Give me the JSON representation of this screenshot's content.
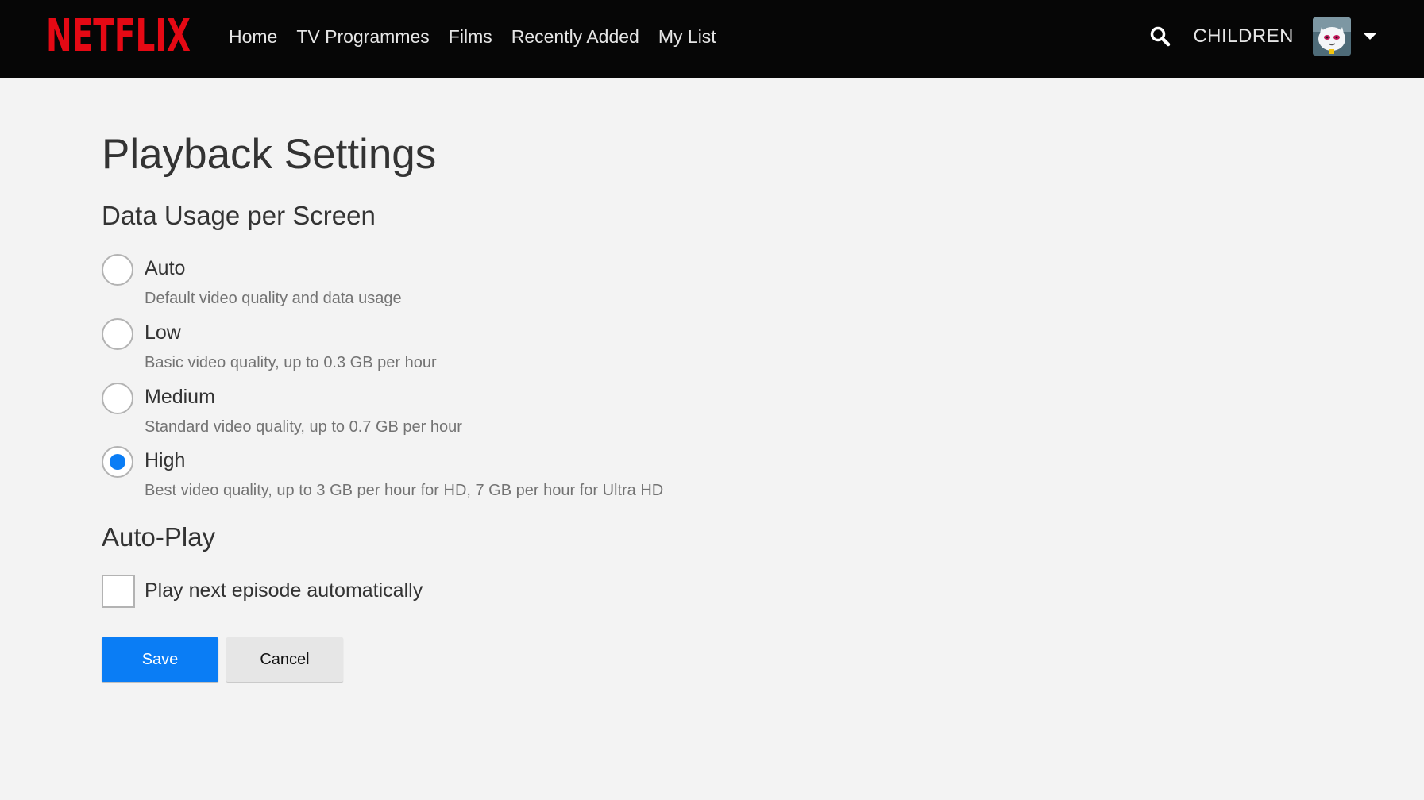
{
  "header": {
    "logo_text": "NETFLIX",
    "nav": [
      {
        "label": "Home"
      },
      {
        "label": "TV Programmes"
      },
      {
        "label": "Films"
      },
      {
        "label": "Recently Added"
      },
      {
        "label": "My List"
      }
    ],
    "profile_name": "CHILDREN",
    "icons": {
      "search": "search-icon",
      "avatar": "avatar",
      "dropdown": "chevron-down-icon"
    }
  },
  "page": {
    "title": "Playback Settings",
    "data_usage": {
      "heading": "Data Usage per Screen",
      "selected": "High",
      "options": [
        {
          "label": "Auto",
          "description": "Default video quality and data usage",
          "checked": false
        },
        {
          "label": "Low",
          "description": "Basic video quality, up to 0.3 GB per hour",
          "checked": false
        },
        {
          "label": "Medium",
          "description": "Standard video quality, up to 0.7 GB per hour",
          "checked": false
        },
        {
          "label": "High",
          "description": "Best video quality, up to 3 GB per hour for HD, 7 GB per hour for Ultra HD",
          "checked": true
        }
      ]
    },
    "autoplay": {
      "heading": "Auto-Play",
      "checkbox_label": "Play next episode automatically",
      "checked": false
    },
    "buttons": {
      "save_label": "Save",
      "cancel_label": "Cancel"
    }
  },
  "colors": {
    "brand_red": "#e50914",
    "header_bg": "#060606",
    "page_bg": "#f3f3f3",
    "accent_blue": "#0a7df5"
  }
}
